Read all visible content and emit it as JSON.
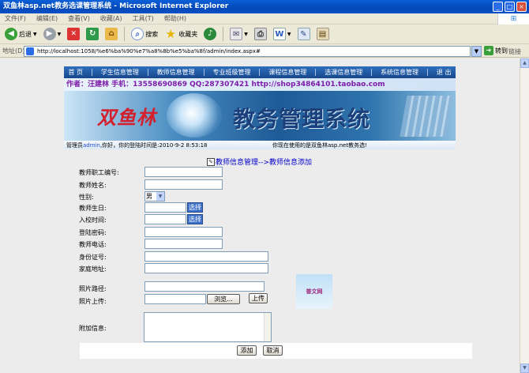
{
  "window": {
    "title": "双鱼林asp.net教务选课管理系统 - Microsoft Internet Explorer",
    "btns": [
      "_",
      "□",
      "×"
    ]
  },
  "menubar": {
    "items": [
      "文件(F)",
      "编辑(E)",
      "查看(V)",
      "收藏(A)",
      "工具(T)",
      "帮助(H)"
    ]
  },
  "toolbar": {
    "back": "后退",
    "search": "搜索",
    "favorites": "收藏夹"
  },
  "address": {
    "label": "地址(D)",
    "url": "http://localhost:1058/%e6%ba%90%e7%a8%8b%e5%ba%8f/admin/index.aspx#",
    "go": "转到",
    "links": "链接"
  },
  "site": {
    "nav": [
      "首 页",
      "学生信息管理",
      "教师信息管理",
      "专业班级管理",
      "课程信息管理",
      "选课信息管理",
      "系统信息管理",
      "退 出"
    ],
    "info": "作者：汪建林  手机：13558690869 QQ:287307421  http://shop34864101.taobao.com",
    "brand": "双鱼林",
    "system": "教务管理系统",
    "status_prefix": "管理员",
    "status_user": "admin",
    "status_suffix": ",你好，你的登陆时间是:2010-9-2 8:53:18",
    "status_right": "你现在使用的是双鱼林asp.net教务选!"
  },
  "form": {
    "title": "教师信息管理-->教师信息添加",
    "labels": {
      "teacher_no": "教师职工编号:",
      "teacher_name": "教师姓名:",
      "sex": "性别:",
      "birthday": "教师生日:",
      "arrive_date": "入校时间:",
      "password": "登陆密码:",
      "phone": "教师电话:",
      "id_card": "身份证号:",
      "address": "家庭地址:",
      "photo_path": "照片路径:",
      "photo_upload": "照片上传:",
      "memo": "附加信息:"
    },
    "sex_value": "男",
    "choose": "选择",
    "browse": "浏览...",
    "upload": "上传",
    "photo_text": "普文网",
    "add": "添加",
    "cancel": "取消"
  }
}
